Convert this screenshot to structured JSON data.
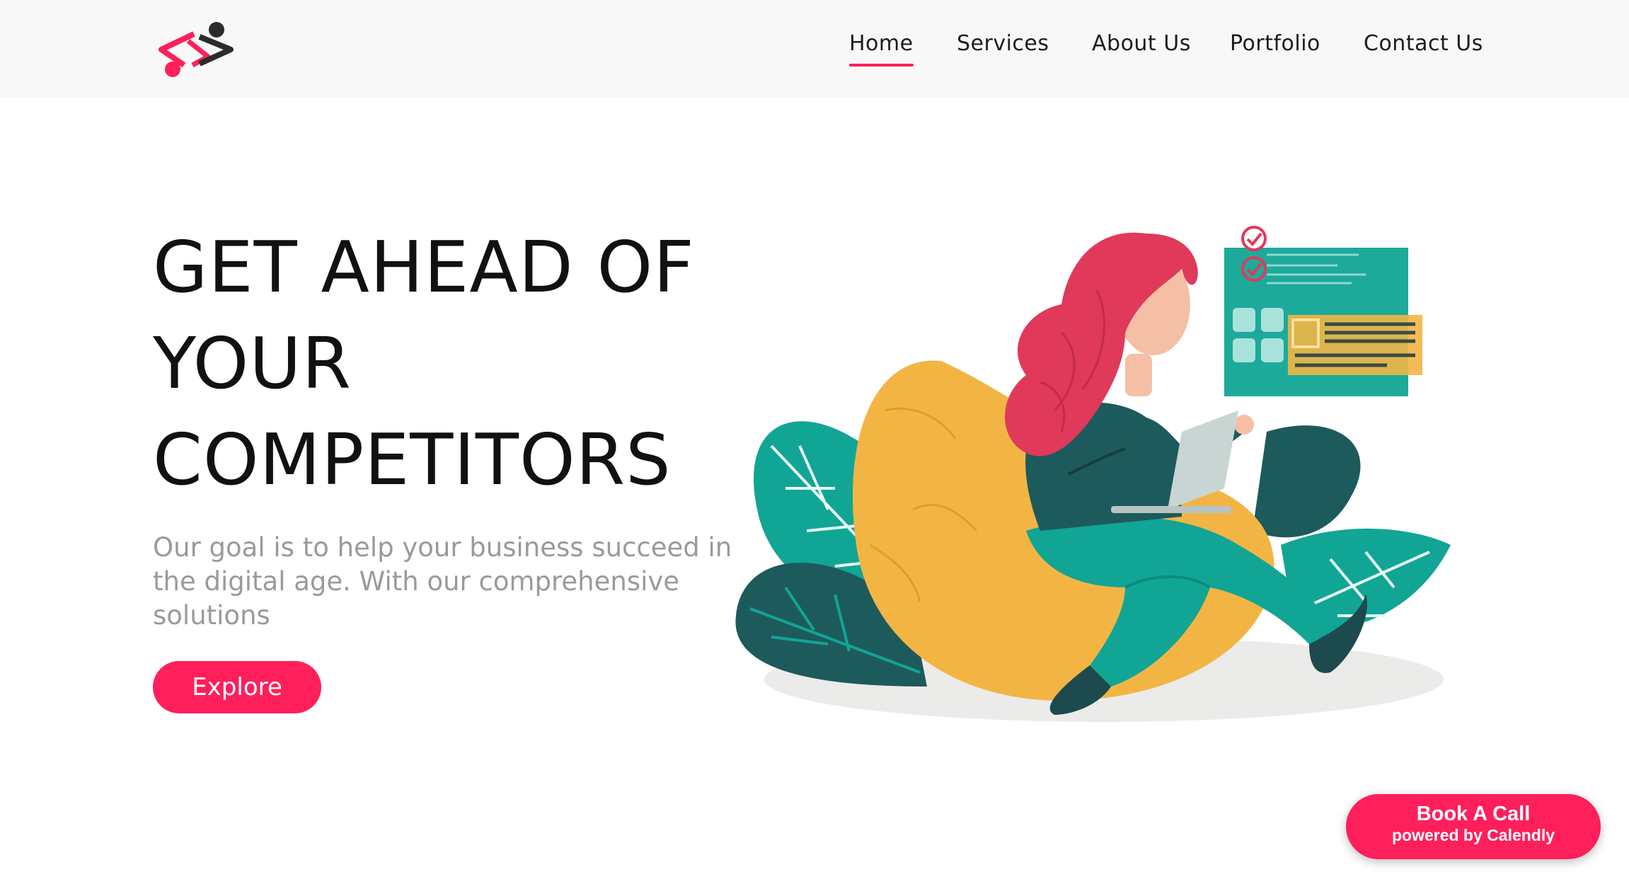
{
  "header": {
    "logo_icon": "brand-logo-icon",
    "nav": [
      {
        "label": "Home",
        "active": true
      },
      {
        "label": "Services",
        "active": false
      },
      {
        "label": "About Us",
        "active": false
      },
      {
        "label": "Portfolio",
        "active": false
      },
      {
        "label": "Contact Us",
        "active": false
      }
    ]
  },
  "hero": {
    "title_lines": [
      "GET AHEAD OF",
      "YOUR",
      "COMPETITORS"
    ],
    "subtitle": "Our goal is to help your business succeed in the digital age. With our comprehensive solutions",
    "cta_label": "Explore"
  },
  "illustration": {
    "description_icon": "woman-with-laptop-illustration-icon"
  },
  "calendly": {
    "main_label": "Book A Call",
    "sub_label": "powered by Calendly"
  },
  "colors": {
    "accent": "#ff1f5a",
    "header_bg": "#f8f8f8",
    "teal": "#11a596",
    "dark_teal": "#1d5a5c",
    "mustard": "#f2b544",
    "hair": "#e0395a"
  }
}
